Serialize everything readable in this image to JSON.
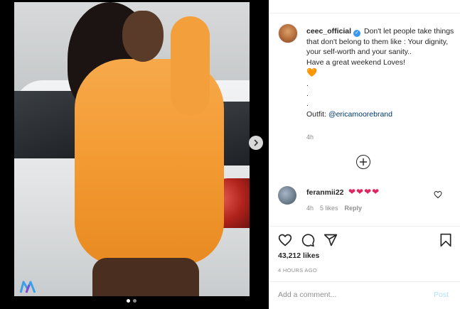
{
  "post": {
    "photo_alt": "",
    "carousel_dots": 2,
    "carousel_active_index": 0
  },
  "caption": {
    "username": "ceec_official",
    "verified": true,
    "text": "Don't let people take things that don't belong to them like : Your dignity, your self-worth and your sanity..\nHave a great weekend Loves!",
    "heart": "🧡",
    "bullets": ".\n.\n.",
    "outfit_label": "Outfit: ",
    "outfit_mention": "@ericamoorebrand",
    "time": "4h"
  },
  "comment": {
    "username": "feranmii22",
    "text": "❤❤❤❤",
    "time": "4h",
    "likes": "5 likes",
    "reply": "Reply"
  },
  "stats": {
    "likes": "43,212 likes",
    "date": "4 HOURS AGO"
  },
  "add_comment": {
    "placeholder": "Add a comment...",
    "post_label": "Post"
  },
  "colors": {
    "accent": "#3897f0",
    "post_disabled": "#b2dffc",
    "heart_orange": "#f27f1e",
    "heart_red": "#e0245e"
  },
  "icons": [
    "chevron-right-icon",
    "plus-circle-icon",
    "heart-icon",
    "comment-icon",
    "share-icon",
    "bookmark-icon",
    "verified-icon"
  ]
}
